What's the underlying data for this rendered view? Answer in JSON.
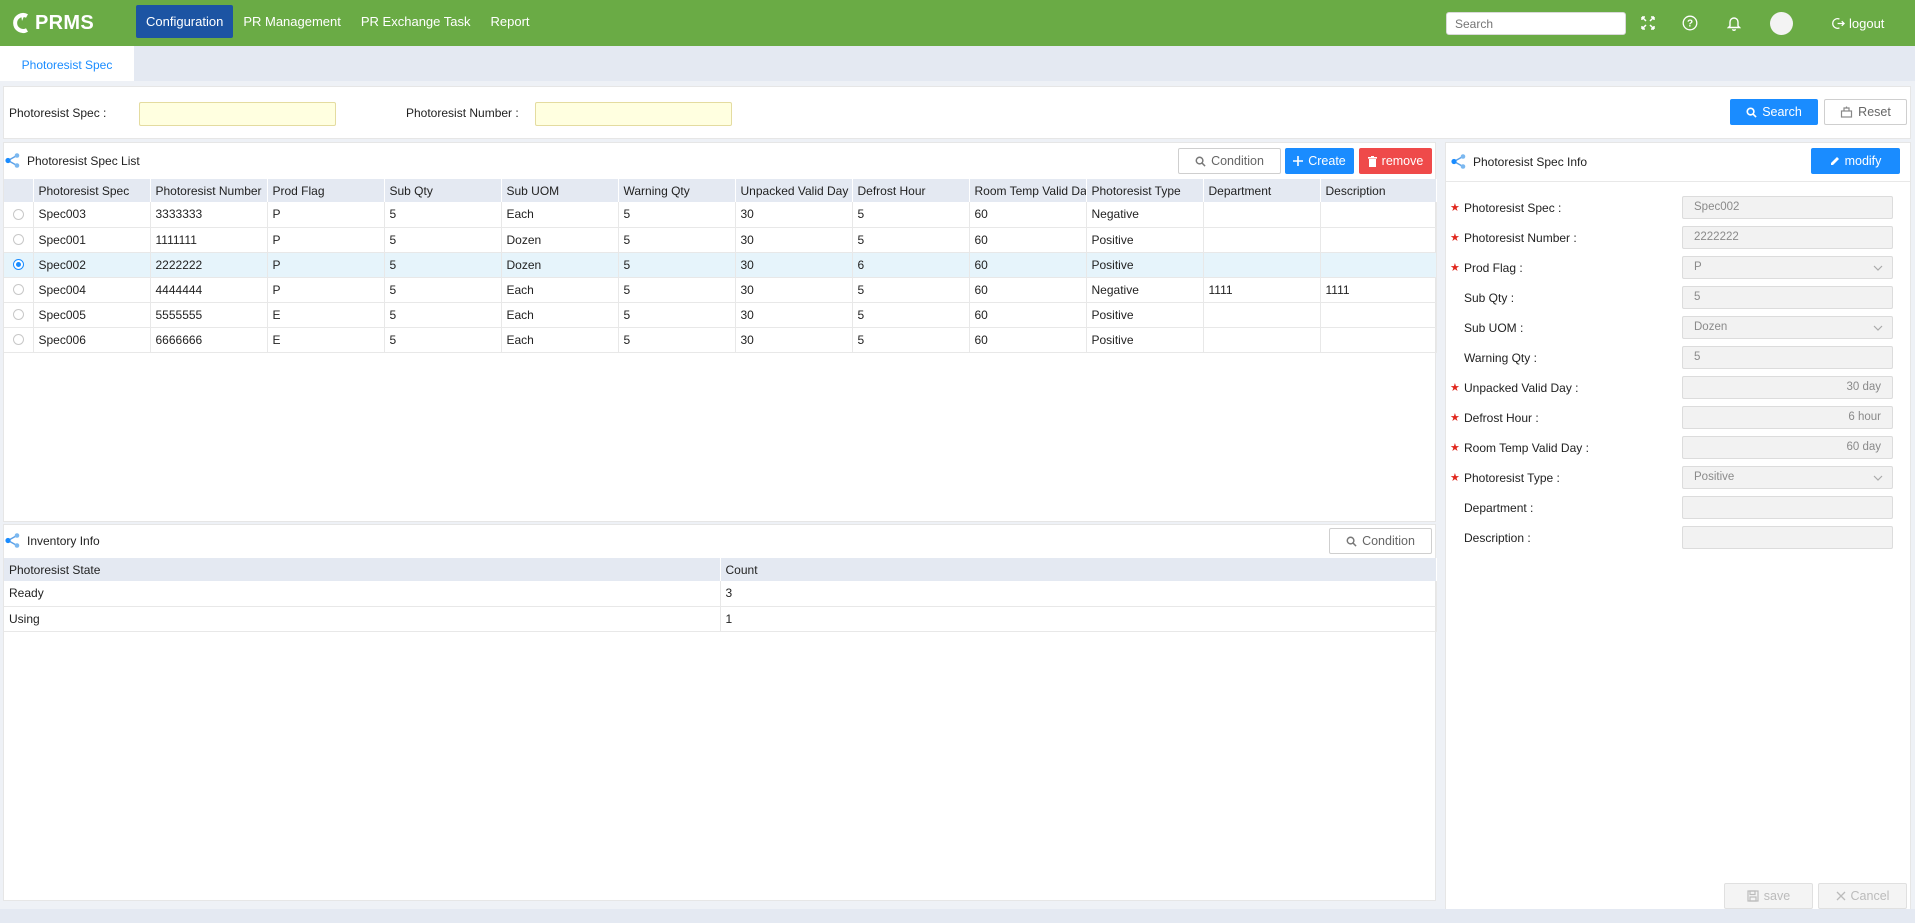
{
  "app": {
    "name": "PRMS"
  },
  "nav": {
    "items": [
      {
        "label": "Configuration",
        "active": true
      },
      {
        "label": "PR Management",
        "active": false
      },
      {
        "label": "PR Exchange Task",
        "active": false
      },
      {
        "label": "Report",
        "active": false
      }
    ],
    "search_placeholder": "Search",
    "logout_label": "logout"
  },
  "tabs": [
    {
      "label": "Photoresist Spec",
      "active": true
    }
  ],
  "query": {
    "spec_label": "Photoresist Spec",
    "spec_value": "",
    "number_label": "Photoresist Number",
    "number_value": "",
    "search_label": "Search",
    "reset_label": "Reset"
  },
  "spec_list": {
    "title": "Photoresist Spec List",
    "condition_label": "Condition",
    "create_label": "Create",
    "remove_label": "remove",
    "columns": [
      "Photoresist Spec",
      "Photoresist Number",
      "Prod Flag",
      "Sub Qty",
      "Sub UOM",
      "Warning Qty",
      "Unpacked Valid Day",
      "Defrost Hour",
      "Room Temp Valid Day",
      "Photoresist Type",
      "Department",
      "Description"
    ],
    "rows": [
      {
        "selected": false,
        "cells": [
          "Spec003",
          "3333333",
          "P",
          "5",
          "Each",
          "5",
          "30",
          "5",
          "60",
          "Negative",
          "",
          ""
        ]
      },
      {
        "selected": false,
        "cells": [
          "Spec001",
          "1111111",
          "P",
          "5",
          "Dozen",
          "5",
          "30",
          "5",
          "60",
          "Positive",
          "",
          ""
        ]
      },
      {
        "selected": true,
        "cells": [
          "Spec002",
          "2222222",
          "P",
          "5",
          "Dozen",
          "5",
          "30",
          "6",
          "60",
          "Positive",
          "",
          ""
        ]
      },
      {
        "selected": false,
        "cells": [
          "Spec004",
          "4444444",
          "P",
          "5",
          "Each",
          "5",
          "30",
          "5",
          "60",
          "Negative",
          "1111",
          "1111"
        ]
      },
      {
        "selected": false,
        "cells": [
          "Spec005",
          "5555555",
          "E",
          "5",
          "Each",
          "5",
          "30",
          "5",
          "60",
          "Positive",
          "",
          ""
        ]
      },
      {
        "selected": false,
        "cells": [
          "Spec006",
          "6666666",
          "E",
          "5",
          "Each",
          "5",
          "30",
          "5",
          "60",
          "Positive",
          "",
          ""
        ]
      }
    ]
  },
  "inventory": {
    "title": "Inventory Info",
    "condition_label": "Condition",
    "columns": [
      "Photoresist State",
      "Count"
    ],
    "rows": [
      [
        "Ready",
        "3"
      ],
      [
        "Using",
        "1"
      ]
    ]
  },
  "spec_info": {
    "title": "Photoresist Spec Info",
    "modify_label": "modify",
    "fields": [
      {
        "label": "Photoresist Spec",
        "required": true,
        "value": "Spec002",
        "type": "text"
      },
      {
        "label": "Photoresist Number",
        "required": true,
        "value": "2222222",
        "type": "text"
      },
      {
        "label": "Prod Flag",
        "required": true,
        "value": "P",
        "type": "select"
      },
      {
        "label": "Sub Qty",
        "required": false,
        "value": "5",
        "type": "text"
      },
      {
        "label": "Sub UOM",
        "required": false,
        "value": "Dozen",
        "type": "select"
      },
      {
        "label": "Warning Qty",
        "required": false,
        "value": "5",
        "type": "text"
      },
      {
        "label": "Unpacked Valid Day",
        "required": true,
        "value": "30 day",
        "type": "unit"
      },
      {
        "label": "Defrost Hour",
        "required": true,
        "value": "6 hour",
        "type": "unit"
      },
      {
        "label": "Room Temp Valid Day",
        "required": true,
        "value": "60 day",
        "type": "unit"
      },
      {
        "label": "Photoresist Type",
        "required": true,
        "value": "Positive",
        "type": "select"
      },
      {
        "label": "Department",
        "required": false,
        "value": "",
        "type": "text"
      },
      {
        "label": "Description",
        "required": false,
        "value": "",
        "type": "text"
      }
    ],
    "save_label": "save",
    "cancel_label": "Cancel"
  },
  "colors": {
    "topbar": "#6aab45",
    "nav_active": "#1c54a3",
    "primary": "#1a8cff",
    "danger": "#ef4a4a",
    "required": "#e0281e",
    "highlight_input": "#ffffe0"
  }
}
